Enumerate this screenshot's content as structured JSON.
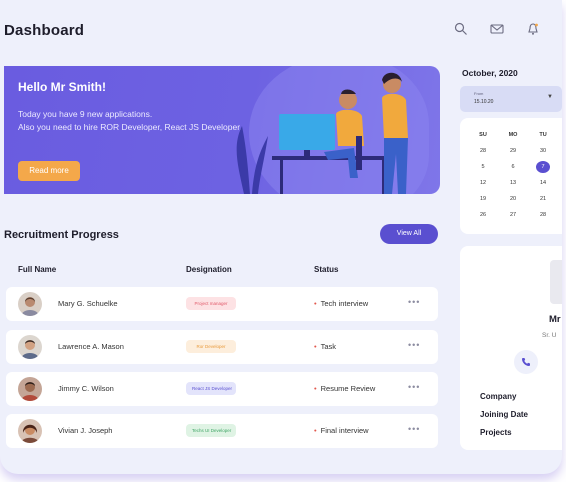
{
  "header": {
    "title": "Dashboard"
  },
  "icons": [
    "search-icon",
    "mail-icon",
    "notification-icon"
  ],
  "hero": {
    "greeting": "Hello Mr Smith!",
    "line1": "Today you have 9 new applications.",
    "line2": "Also you need to hire ROR Developer, React JS Developer.",
    "button": "Read more"
  },
  "recruitment": {
    "title": "Recruitment Progress",
    "view_all": "View All",
    "columns": {
      "name": "Full Name",
      "designation": "Designation",
      "status": "Status"
    },
    "rows": [
      {
        "name": "Mary G. Schuelke",
        "designation": "Project manager",
        "status": "Tech interview",
        "badge_color": "#fde2e4",
        "badge_text": "#e15b6b"
      },
      {
        "name": "Lawrence A. Mason",
        "designation": "Ror Developer",
        "status": "Task",
        "badge_color": "#fdeedc",
        "badge_text": "#e89a3c"
      },
      {
        "name": "Jimmy C. Wilson",
        "designation": "React JS Developer",
        "status": "Resume Review",
        "badge_color": "#e3e4fb",
        "badge_text": "#5a4fd0"
      },
      {
        "name": "Vivian J. Joseph",
        "designation": "Techs UI Developer",
        "status": "Final interview",
        "badge_color": "#dff3e4",
        "badge_text": "#3fa565"
      }
    ],
    "more": "•••"
  },
  "calendar": {
    "month": "October, 2020",
    "field_label": "From",
    "field_value": "15.10.20",
    "days": [
      "SU",
      "MO",
      "TU"
    ],
    "dates": [
      [
        "28",
        "29",
        "30"
      ],
      [
        "5",
        "6",
        "7"
      ],
      [
        "12",
        "13",
        "14"
      ],
      [
        "19",
        "20",
        "21"
      ],
      [
        "26",
        "27",
        "28"
      ]
    ],
    "selected": "7"
  },
  "profile": {
    "name": "Mr",
    "role": "Sr. U",
    "fields": [
      "Company",
      "Joining Date",
      "Projects"
    ]
  }
}
